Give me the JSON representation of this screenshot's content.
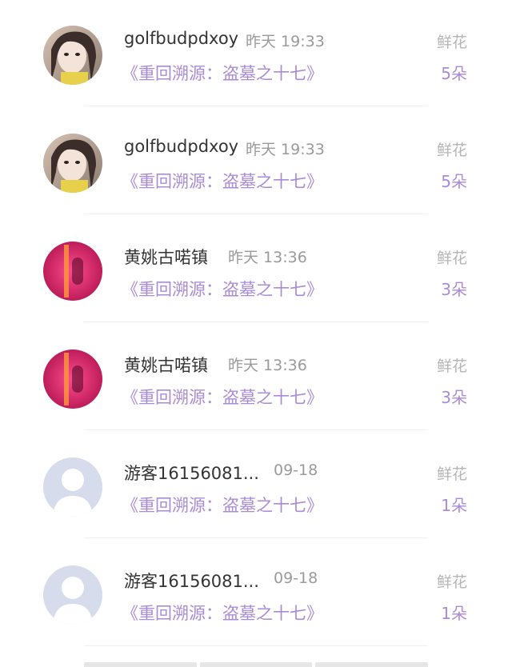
{
  "comments": [
    {
      "user": "golfbudpdxoy",
      "time": "昨天 19:33",
      "book": "《重回溯源：盗墓之十七》",
      "gift_label": "鲜花",
      "gift_count": "5朵",
      "avatar": "photo-girl"
    },
    {
      "user": "golfbudpdxoy",
      "time": "昨天 19:33",
      "book": "《重回溯源：盗墓之十七》",
      "gift_label": "鲜花",
      "gift_count": "5朵",
      "avatar": "photo-girl"
    },
    {
      "user": "黄姚古喏镇",
      "time": "昨天 13:36",
      "book": "《重回溯源：盗墓之十七》",
      "gift_label": "鲜花",
      "gift_count": "3朵",
      "avatar": "neon-pink"
    },
    {
      "user": "黄姚古喏镇",
      "time": "昨天 13:36",
      "book": "《重回溯源：盗墓之十七》",
      "gift_label": "鲜花",
      "gift_count": "3朵",
      "avatar": "neon-pink"
    },
    {
      "user": "游客16156081...",
      "time": "09-18",
      "book": "《重回溯源：盗墓之十七》",
      "gift_label": "鲜花",
      "gift_count": "1朵",
      "avatar": "default-user"
    },
    {
      "user": "游客16156081...",
      "time": "09-18",
      "book": "《重回溯源：盗墓之十七》",
      "gift_label": "鲜花",
      "gift_count": "1朵",
      "avatar": "default-user"
    }
  ],
  "colors": {
    "accent": "#a98bd8",
    "muted": "#9a9a9a",
    "text": "#333333",
    "default_avatar_bg": "#d6dceb"
  }
}
